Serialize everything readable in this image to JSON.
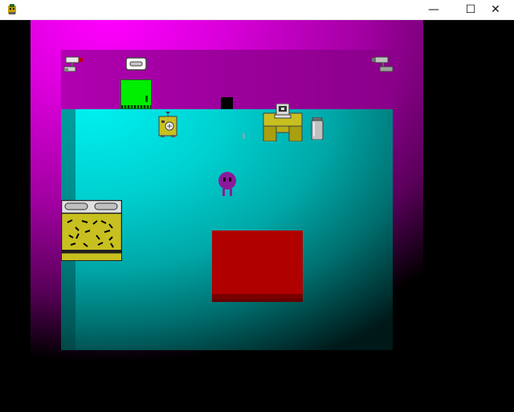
{
  "window": {
    "minimize_glyph": "—",
    "maximize_glyph": "☐",
    "close_glyph": "✕"
  },
  "scene": {
    "colors": {
      "outer_wall": "#d800d8",
      "back_wall": "#a000a0",
      "floor": "#00c8c8",
      "door": "#00ee00",
      "rug": "#b00000",
      "player": "#8a1a9a",
      "furniture": "#c8c020"
    },
    "objects": {
      "camera_left": "security-camera-icon",
      "camera_right": "security-camera-icon",
      "ceiling_light": "ceiling-light-icon",
      "door": "green-door",
      "radio": "radio-icon",
      "desk": "computer-desk-icon",
      "trash": "trash-can-icon",
      "player": "purple-blob-character",
      "counter": "counter-with-stovetop-icon",
      "rug": "red-rug"
    }
  }
}
